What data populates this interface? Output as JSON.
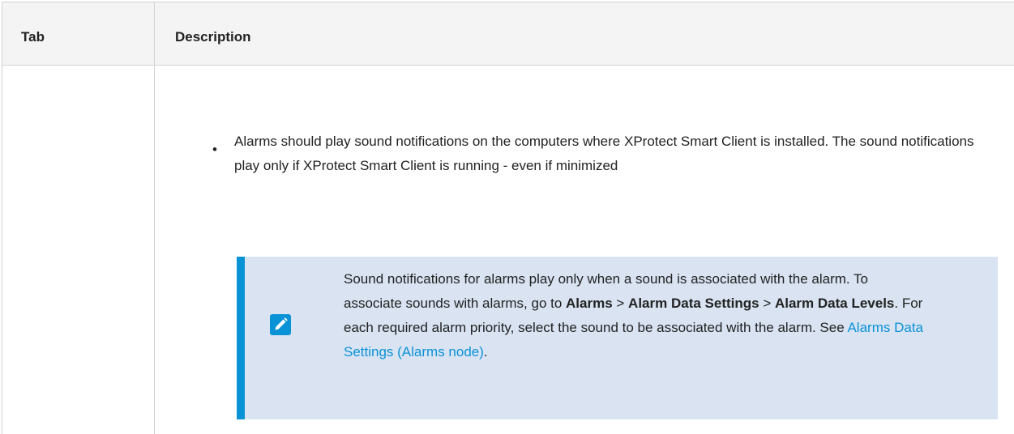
{
  "table": {
    "headers": {
      "tab": "Tab",
      "description": "Description"
    }
  },
  "row": {
    "bullet_text": "Alarms should play sound notifications on the computers where XProtect Smart Client is installed. The sound notifications play only if XProtect Smart Client is running - even if minimized",
    "note": {
      "icon": "pencil-icon",
      "text_1": "Sound notifications for alarms play only when a sound is associated with the alarm. To associate sounds with alarms, go to ",
      "menu_1": "Alarms",
      "sep_1": " > ",
      "menu_2": "Alarm Data Settings",
      "sep_2": " > ",
      "menu_3": "Alarm Data Levels",
      "text_2": ". For each required alarm priority, select the sound to be associated with the alarm. See ",
      "link": "Alarms Data Settings (Alarms node)",
      "text_3": "."
    }
  },
  "colors": {
    "accent": "#0a92d6",
    "note_background": "#d9e3f2",
    "header_background": "#f4f4f4"
  }
}
